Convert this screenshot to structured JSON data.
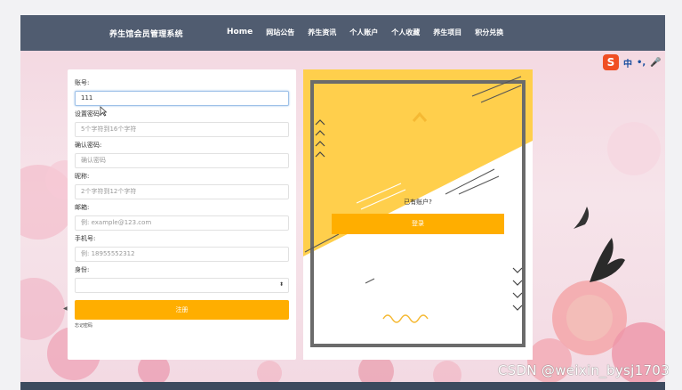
{
  "header": {
    "brand": "养生馆会员管理系统",
    "nav": [
      {
        "label": "Home"
      },
      {
        "label": "网站公告"
      },
      {
        "label": "养生资讯"
      },
      {
        "label": "个人账户"
      },
      {
        "label": "个人收藏"
      },
      {
        "label": "养生项目"
      },
      {
        "label": "积分兑换"
      }
    ]
  },
  "ime": {
    "logo": "S",
    "mode": "中"
  },
  "form": {
    "account_label": "账号:",
    "account_value": "111",
    "password_label": "设置密码:",
    "password_placeholder": "5个字符到16个字符",
    "confirm_label": "确认密码:",
    "confirm_placeholder": "确认密码",
    "nickname_label": "昵称:",
    "nickname_placeholder": "2个字符到12个字符",
    "email_label": "邮箱:",
    "email_placeholder": "例: example@123.com",
    "phone_label": "手机号:",
    "phone_placeholder": "例: 18955552312",
    "role_label": "身份:",
    "role_value": "",
    "register_label": "注册",
    "forgot_label": "忘记密码"
  },
  "art": {
    "have_account": "已有账户?",
    "login_label": "登录"
  },
  "colors": {
    "accent": "#ffae00",
    "header": "#505c70",
    "art_yellow": "#ffcf4c"
  },
  "watermark": "CSDN @weixin_bysj1703"
}
